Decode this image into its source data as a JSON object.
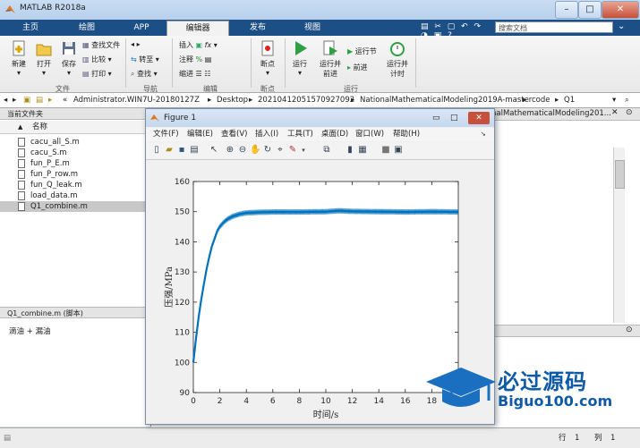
{
  "window": {
    "title": "MATLAB R2018a",
    "minimize": "–",
    "maximize": "□",
    "close": "✕"
  },
  "tabs": [
    "主页",
    "绘图",
    "APP",
    "编辑器",
    "发布",
    "视图"
  ],
  "search": {
    "placeholder": "搜索文档"
  },
  "ribbon": {
    "file": {
      "new": "新建",
      "open": "打开",
      "save": "保存",
      "find_files": "查找文件",
      "compare": "比较",
      "print": "打印",
      "group": "文件"
    },
    "nav": {
      "goto": "转至",
      "find": "查找",
      "group": "导航"
    },
    "edit": {
      "insert": "插入",
      "comment": "注释",
      "indent": "缩进",
      "group": "编辑"
    },
    "breakpoints": {
      "label": "断点",
      "group": "断点"
    },
    "run": {
      "run": "运行",
      "run_advance_1": "运行并",
      "run_advance_2": "前进",
      "run_section": "运行节",
      "advance": "前进",
      "run_time_1": "运行并",
      "run_time_2": "计时",
      "group": "运行"
    }
  },
  "address": {
    "segments": [
      "«",
      "Administrator.WIN7U-20180127Z",
      "Desktop",
      "20210412051570927092",
      "NationalMathematicalModeling2019A-master",
      "code",
      "Q1"
    ]
  },
  "left_panel": {
    "header": "当前文件夹",
    "col_name": "名称",
    "sort_arrow": "▲",
    "files": [
      "cacu_all_S.m",
      "cacu_S.m",
      "fun_P_E.m",
      "fun_P_row.m",
      "fun_Q_leak.m",
      "load_data.m",
      "Q1_combine.m"
    ],
    "selected_file": "Q1_combine.m",
    "detail_header": "Q1_combine.m (脚本)",
    "detail_text": "滴油 + 漏油"
  },
  "editor": {
    "path_tail": "nalMathematicalModeling201..."
  },
  "status": {
    "row_label": "行",
    "row": "1",
    "col_label": "列",
    "col": "1"
  },
  "figure": {
    "title": "Figure 1",
    "menu": [
      "文件(F)",
      "编辑(E)",
      "查看(V)",
      "插入(I)",
      "工具(T)",
      "桌面(D)",
      "窗口(W)",
      "帮助(H)"
    ]
  },
  "chart_data": {
    "type": "line",
    "xlabel": "时间/s",
    "ylabel": "压强/MPa",
    "xlim": [
      0,
      20
    ],
    "ylim": [
      90,
      160
    ],
    "xticks": [
      0,
      2,
      4,
      6,
      8,
      10,
      12,
      14,
      16,
      18,
      20
    ],
    "yticks": [
      90,
      100,
      110,
      120,
      130,
      140,
      150,
      160
    ],
    "color": "#0072BD",
    "series": [
      {
        "x": [
          0,
          0.2,
          0.4,
          0.6,
          0.8,
          1.0,
          1.2,
          1.4,
          1.6,
          1.8,
          2.0,
          2.3,
          2.6,
          3.0,
          3.5,
          4.0,
          5.0,
          6.0,
          8.0,
          10.0,
          11.0,
          12.0,
          14.0,
          16.0,
          18.0,
          20.0
        ],
        "y": [
          100,
          108,
          115,
          121,
          126,
          131,
          135,
          138.5,
          141,
          143.5,
          145,
          146.5,
          147.6,
          148.5,
          149.2,
          149.6,
          149.8,
          149.9,
          149.9,
          150,
          150.3,
          150.1,
          150,
          149.9,
          150,
          149.9
        ]
      }
    ]
  },
  "watermark": {
    "brand": "必过源码",
    "site": "Biguo100.com"
  }
}
